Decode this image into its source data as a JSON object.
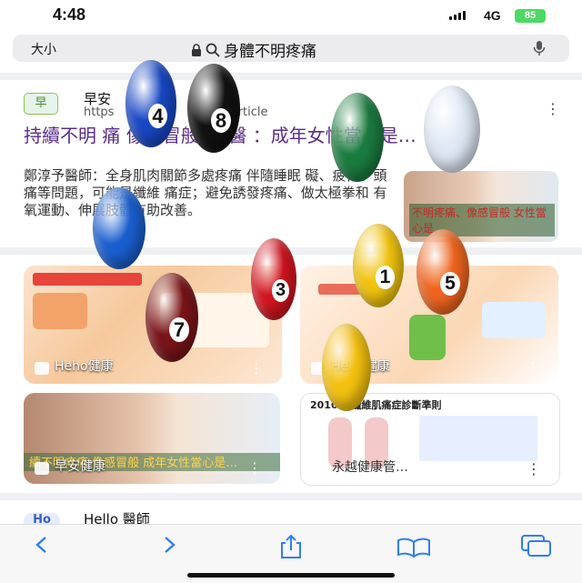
{
  "status": {
    "time": "4:48",
    "network": "4G",
    "battery": "85"
  },
  "address_bar": {
    "text_size_label": "大小",
    "query": "身體不明疼痛"
  },
  "result1": {
    "logo": "早",
    "site_name": "早安",
    "url": "https",
    "url_tail": "· article",
    "title": "持續不明 痛 像感冒般 ！ 醫 ：成年女性當心是…",
    "snippet": "鄭淳予醫師：全身肌肉關節多處疼痛 伴隨睡眠 礙、疲倦、頭痛等問題，可能是纖維 痛症；避免誘發疼痛、做太極拳和 有氧運動、伸展肢體有助改善。",
    "thumb_caption": "不明疼痛、像感冒般 女性當心是"
  },
  "image_cards": [
    {
      "label": "Heho健康",
      "banner": ""
    },
    {
      "label": "Heho健康",
      "banner": ""
    },
    {
      "label": "早安健康",
      "banner": "續不明疼痛 像感冒般 成年女性當心是…"
    },
    {
      "label": "永越健康管…",
      "banner": ""
    }
  ],
  "card4_heading": "2010年 纖維肌痛症診斷準則",
  "result2": {
    "logo": "Ho",
    "site_name": "Hello 醫師"
  },
  "balls": [
    {
      "number": "4",
      "color": "#1747c4"
    },
    {
      "number": "8",
      "color": "#111111"
    },
    {
      "number": "",
      "color": "#1b7c3f"
    },
    {
      "number": "",
      "color": "#dfe8f5"
    },
    {
      "number": "",
      "color": "#1a5fd0"
    },
    {
      "number": "3",
      "color": "#d3141f"
    },
    {
      "number": "1",
      "color": "#f1c40f"
    },
    {
      "number": "5",
      "color": "#f0641e"
    },
    {
      "number": "7",
      "color": "#7a1418"
    },
    {
      "number": "",
      "color": "#f4c20f"
    }
  ],
  "icons": {
    "lock": "lock-icon",
    "search": "search-icon",
    "mic": "mic-icon",
    "back": "back-icon",
    "forward": "forward-icon",
    "share": "share-icon",
    "bookmarks": "bookmarks-icon",
    "tabs": "tabs-icon"
  }
}
